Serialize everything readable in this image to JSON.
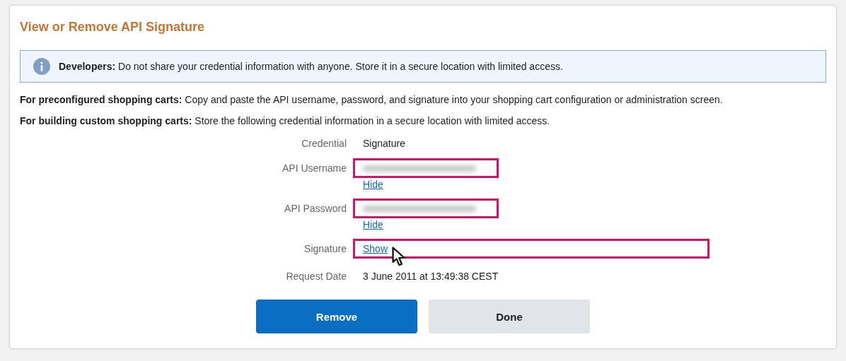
{
  "title": "View or Remove API Signature",
  "notice": {
    "text": "**Developers:** Do not share your credential information with anyone. Store it in a secure location with limited access."
  },
  "paragraphs": [
    "**For preconfigured shopping carts:** Copy and paste the API username, password, and signature into your shopping cart configuration or administration screen.",
    "**For building custom shopping carts:** Store the following credential information in a secure location with limited access."
  ],
  "fields": [
    {
      "label": "Credential",
      "kind": "text",
      "value": "Signature",
      "highlighted": false
    },
    {
      "label": "API Username",
      "kind": "masked",
      "link": "Hide",
      "highlighted": true
    },
    {
      "label": "API Password",
      "kind": "masked",
      "link": "Hide",
      "highlighted": true
    },
    {
      "label": "Signature",
      "kind": "link",
      "link": "Show",
      "highlighted": true
    },
    {
      "label": "Request Date",
      "kind": "text",
      "value": "3 June 2011 at 13:49:38 CEST",
      "highlighted": false
    }
  ],
  "buttons": [
    {
      "label": "Remove",
      "kind": "primary"
    },
    {
      "label": "Done",
      "kind": "secondary"
    }
  ]
}
